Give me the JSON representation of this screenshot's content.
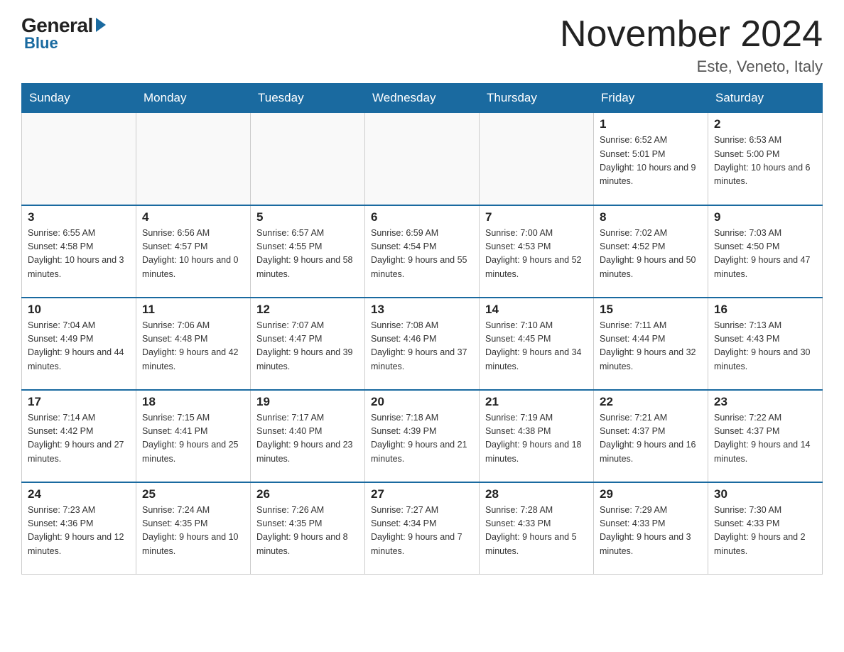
{
  "header": {
    "logo_general": "General",
    "logo_blue": "Blue",
    "month_year": "November 2024",
    "location": "Este, Veneto, Italy"
  },
  "days_of_week": [
    "Sunday",
    "Monday",
    "Tuesday",
    "Wednesday",
    "Thursday",
    "Friday",
    "Saturday"
  ],
  "weeks": [
    [
      {
        "day": "",
        "info": ""
      },
      {
        "day": "",
        "info": ""
      },
      {
        "day": "",
        "info": ""
      },
      {
        "day": "",
        "info": ""
      },
      {
        "day": "",
        "info": ""
      },
      {
        "day": "1",
        "info": "Sunrise: 6:52 AM\nSunset: 5:01 PM\nDaylight: 10 hours and 9 minutes."
      },
      {
        "day": "2",
        "info": "Sunrise: 6:53 AM\nSunset: 5:00 PM\nDaylight: 10 hours and 6 minutes."
      }
    ],
    [
      {
        "day": "3",
        "info": "Sunrise: 6:55 AM\nSunset: 4:58 PM\nDaylight: 10 hours and 3 minutes."
      },
      {
        "day": "4",
        "info": "Sunrise: 6:56 AM\nSunset: 4:57 PM\nDaylight: 10 hours and 0 minutes."
      },
      {
        "day": "5",
        "info": "Sunrise: 6:57 AM\nSunset: 4:55 PM\nDaylight: 9 hours and 58 minutes."
      },
      {
        "day": "6",
        "info": "Sunrise: 6:59 AM\nSunset: 4:54 PM\nDaylight: 9 hours and 55 minutes."
      },
      {
        "day": "7",
        "info": "Sunrise: 7:00 AM\nSunset: 4:53 PM\nDaylight: 9 hours and 52 minutes."
      },
      {
        "day": "8",
        "info": "Sunrise: 7:02 AM\nSunset: 4:52 PM\nDaylight: 9 hours and 50 minutes."
      },
      {
        "day": "9",
        "info": "Sunrise: 7:03 AM\nSunset: 4:50 PM\nDaylight: 9 hours and 47 minutes."
      }
    ],
    [
      {
        "day": "10",
        "info": "Sunrise: 7:04 AM\nSunset: 4:49 PM\nDaylight: 9 hours and 44 minutes."
      },
      {
        "day": "11",
        "info": "Sunrise: 7:06 AM\nSunset: 4:48 PM\nDaylight: 9 hours and 42 minutes."
      },
      {
        "day": "12",
        "info": "Sunrise: 7:07 AM\nSunset: 4:47 PM\nDaylight: 9 hours and 39 minutes."
      },
      {
        "day": "13",
        "info": "Sunrise: 7:08 AM\nSunset: 4:46 PM\nDaylight: 9 hours and 37 minutes."
      },
      {
        "day": "14",
        "info": "Sunrise: 7:10 AM\nSunset: 4:45 PM\nDaylight: 9 hours and 34 minutes."
      },
      {
        "day": "15",
        "info": "Sunrise: 7:11 AM\nSunset: 4:44 PM\nDaylight: 9 hours and 32 minutes."
      },
      {
        "day": "16",
        "info": "Sunrise: 7:13 AM\nSunset: 4:43 PM\nDaylight: 9 hours and 30 minutes."
      }
    ],
    [
      {
        "day": "17",
        "info": "Sunrise: 7:14 AM\nSunset: 4:42 PM\nDaylight: 9 hours and 27 minutes."
      },
      {
        "day": "18",
        "info": "Sunrise: 7:15 AM\nSunset: 4:41 PM\nDaylight: 9 hours and 25 minutes."
      },
      {
        "day": "19",
        "info": "Sunrise: 7:17 AM\nSunset: 4:40 PM\nDaylight: 9 hours and 23 minutes."
      },
      {
        "day": "20",
        "info": "Sunrise: 7:18 AM\nSunset: 4:39 PM\nDaylight: 9 hours and 21 minutes."
      },
      {
        "day": "21",
        "info": "Sunrise: 7:19 AM\nSunset: 4:38 PM\nDaylight: 9 hours and 18 minutes."
      },
      {
        "day": "22",
        "info": "Sunrise: 7:21 AM\nSunset: 4:37 PM\nDaylight: 9 hours and 16 minutes."
      },
      {
        "day": "23",
        "info": "Sunrise: 7:22 AM\nSunset: 4:37 PM\nDaylight: 9 hours and 14 minutes."
      }
    ],
    [
      {
        "day": "24",
        "info": "Sunrise: 7:23 AM\nSunset: 4:36 PM\nDaylight: 9 hours and 12 minutes."
      },
      {
        "day": "25",
        "info": "Sunrise: 7:24 AM\nSunset: 4:35 PM\nDaylight: 9 hours and 10 minutes."
      },
      {
        "day": "26",
        "info": "Sunrise: 7:26 AM\nSunset: 4:35 PM\nDaylight: 9 hours and 8 minutes."
      },
      {
        "day": "27",
        "info": "Sunrise: 7:27 AM\nSunset: 4:34 PM\nDaylight: 9 hours and 7 minutes."
      },
      {
        "day": "28",
        "info": "Sunrise: 7:28 AM\nSunset: 4:33 PM\nDaylight: 9 hours and 5 minutes."
      },
      {
        "day": "29",
        "info": "Sunrise: 7:29 AM\nSunset: 4:33 PM\nDaylight: 9 hours and 3 minutes."
      },
      {
        "day": "30",
        "info": "Sunrise: 7:30 AM\nSunset: 4:33 PM\nDaylight: 9 hours and 2 minutes."
      }
    ]
  ]
}
